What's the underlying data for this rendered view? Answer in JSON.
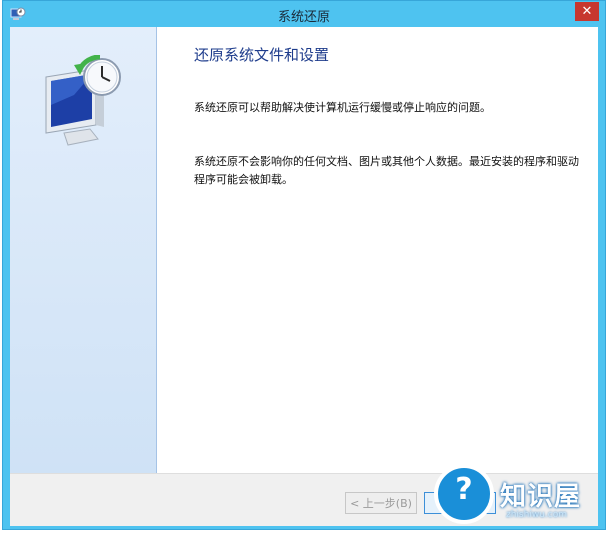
{
  "window": {
    "title": "系统还原",
    "close_glyph": "✕"
  },
  "content": {
    "heading": "还原系统文件和设置",
    "paragraph1": "系统还原可以帮助解决使计算机运行缓慢或停止响应的问题。",
    "paragraph2": "系统还原不会影响你的任何文档、图片或其他个人数据。最近安装的程序和驱动程序可能会被卸载。"
  },
  "buttons": {
    "back_label": "< 上一步(B)"
  },
  "watermark": {
    "brand": "知识屋",
    "url": "zhishiwu.com"
  },
  "icons": {
    "app": "system-restore-icon",
    "hero": "monitor-clock-restore-icon",
    "watermark": "question-mark-icon"
  }
}
